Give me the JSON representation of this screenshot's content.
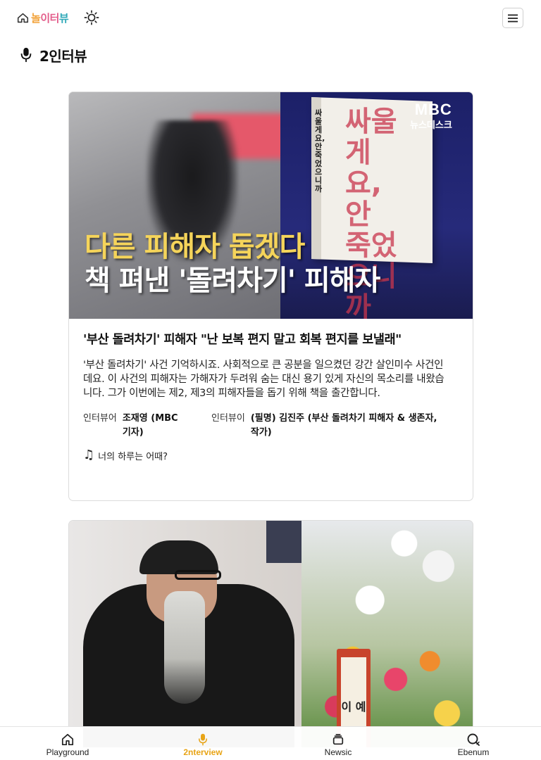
{
  "app": {
    "logo_text_1": "놀",
    "logo_text_2": "이터",
    "logo_text_3": "뷰",
    "theme_icon": "sun-icon",
    "menu_icon": "hamburger-icon",
    "colors": {
      "accent": "#e8a416",
      "logo_orange": "#f2a33a",
      "logo_pink": "#e35d8b",
      "logo_teal": "#2fa9b8"
    }
  },
  "page": {
    "title": "2인터뷰",
    "title_icon": "microphone-icon"
  },
  "cards": [
    {
      "thumbnail": {
        "brand_line1": "MBC",
        "brand_line2": "뉴스데스크",
        "book_spine": "싸울게요, 안 죽었으니까",
        "book_title": "싸울게요, 안 죽었으니까",
        "headline_line1": "다른 피해자 돕겠다",
        "headline_line2": "책 펴낸 '돌려차기' 피해자"
      },
      "title": "'부산 돌려차기' 피해자 \"난 보복 편지 말고 회복 편지를 보낼래\"",
      "description": "'부산 돌려차기' 사건 기억하시죠. 사회적으로 큰 공분을 일으켰던 강간 살인미수 사건인데요. 이 사건의 피해자는 가해자가 두려워 숨는 대신 용기 있게 자신의 목소리를 내왔습니다. 그가 이번에는 제2, 제3의 피해자들을 돕기 위해 책을 출간합니다.",
      "interviewer_label": "인터뷰어",
      "interviewer": "조재영 (MBC 기자)",
      "interviewee_label": "인터뷰이",
      "interviewee": "(필명) 김진주 (부산 돌려차기 피해자 & 생존자, 작가)",
      "song_icon": "music-note-icon",
      "song": "너의 하루는 어때?"
    },
    {
      "thumbnail": {
        "banner_text": "이 예"
      }
    }
  ],
  "bottom_nav": [
    {
      "label": "Playground",
      "icon": "home-icon",
      "active": false
    },
    {
      "label": "2nterview",
      "icon": "microphone-icon",
      "active": true
    },
    {
      "label": "Newsic",
      "icon": "stack-icon",
      "active": false
    },
    {
      "label": "Ebenum",
      "icon": "search-chat-icon",
      "active": false
    }
  ]
}
